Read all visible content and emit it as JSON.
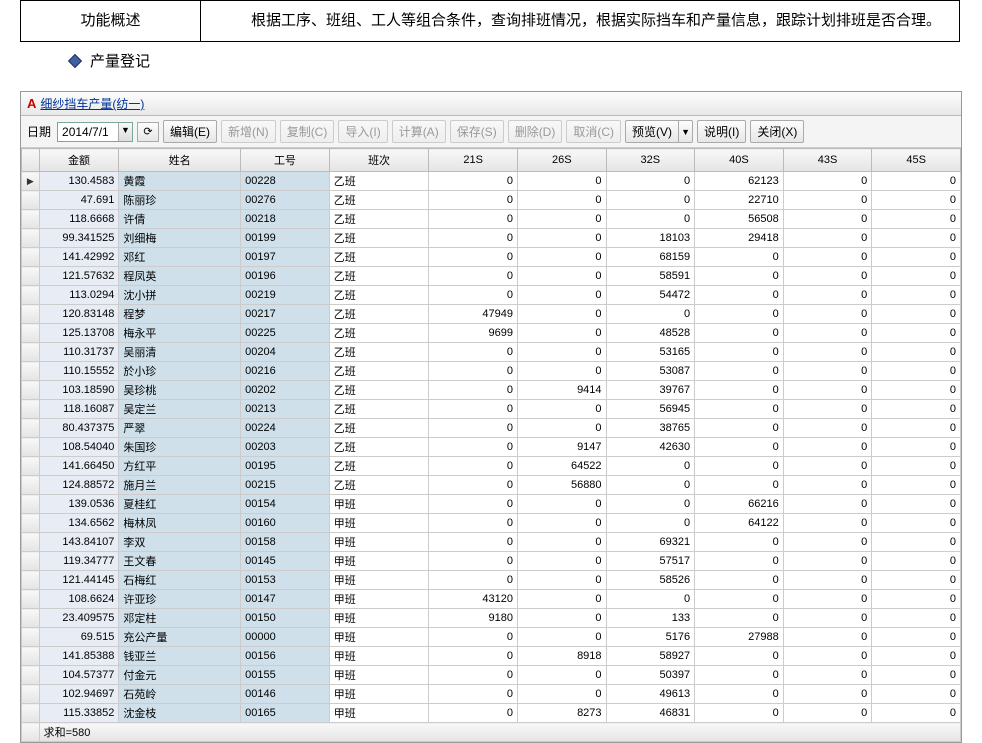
{
  "desc": {
    "label": "功能概述",
    "content": "根据工序、班组、工人等组合条件，查询排班情况，根据实际挡车和产量信息，跟踪计划排班是否合理。"
  },
  "sub_title": "产量登记",
  "window": {
    "title": "细纱挡车产量(纺一)"
  },
  "toolbar": {
    "date_label": "日期",
    "date_value": "2014/7/1",
    "refresh": "⟳",
    "edit": "编辑(E)",
    "add": "新增(N)",
    "copy": "复制(C)",
    "import": "导入(I)",
    "calc": "计算(A)",
    "save": "保存(S)",
    "delete": "删除(D)",
    "cancel": "取消(C)",
    "preview": "预览(V)",
    "help": "说明(I)",
    "close": "关闭(X)"
  },
  "columns": {
    "amount": "金额",
    "name": "姓名",
    "id": "工号",
    "shift": "班次",
    "c21s": "21S",
    "c26s": "26S",
    "c32s": "32S",
    "c40s": "40S",
    "c43s": "43S",
    "c45s": "45S"
  },
  "rows": [
    {
      "amount": "130.4583",
      "name": "黄霞",
      "id": "00228",
      "shift": "乙班",
      "v": [
        0,
        0,
        0,
        62123,
        0,
        0
      ],
      "mark": "▶"
    },
    {
      "amount": "47.691",
      "name": "陈丽珍",
      "id": "00276",
      "shift": "乙班",
      "v": [
        0,
        0,
        0,
        22710,
        0,
        0
      ]
    },
    {
      "amount": "118.6668",
      "name": "许倩",
      "id": "00218",
      "shift": "乙班",
      "v": [
        0,
        0,
        0,
        56508,
        0,
        0
      ]
    },
    {
      "amount": "99.341525",
      "name": "刘细梅",
      "id": "00199",
      "shift": "乙班",
      "v": [
        0,
        0,
        18103,
        29418,
        0,
        0
      ]
    },
    {
      "amount": "141.42992",
      "name": "邓红",
      "id": "00197",
      "shift": "乙班",
      "v": [
        0,
        0,
        68159,
        0,
        0,
        0
      ]
    },
    {
      "amount": "121.57632",
      "name": "程凤英",
      "id": "00196",
      "shift": "乙班",
      "v": [
        0,
        0,
        58591,
        0,
        0,
        0
      ]
    },
    {
      "amount": "113.0294",
      "name": "沈小拼",
      "id": "00219",
      "shift": "乙班",
      "v": [
        0,
        0,
        54472,
        0,
        0,
        0
      ]
    },
    {
      "amount": "120.83148",
      "name": "程梦",
      "id": "00217",
      "shift": "乙班",
      "v": [
        47949,
        0,
        0,
        0,
        0,
        0
      ]
    },
    {
      "amount": "125.13708",
      "name": "梅永平",
      "id": "00225",
      "shift": "乙班",
      "v": [
        9699,
        0,
        48528,
        0,
        0,
        0
      ]
    },
    {
      "amount": "110.31737",
      "name": "吴丽清",
      "id": "00204",
      "shift": "乙班",
      "v": [
        0,
        0,
        53165,
        0,
        0,
        0
      ]
    },
    {
      "amount": "110.15552",
      "name": "於小珍",
      "id": "00216",
      "shift": "乙班",
      "v": [
        0,
        0,
        53087,
        0,
        0,
        0
      ]
    },
    {
      "amount": "103.18590",
      "name": "吴珍桃",
      "id": "00202",
      "shift": "乙班",
      "v": [
        0,
        9414,
        39767,
        0,
        0,
        0
      ]
    },
    {
      "amount": "118.16087",
      "name": "吴定兰",
      "id": "00213",
      "shift": "乙班",
      "v": [
        0,
        0,
        56945,
        0,
        0,
        0
      ]
    },
    {
      "amount": "80.437375",
      "name": "严翠",
      "id": "00224",
      "shift": "乙班",
      "v": [
        0,
        0,
        38765,
        0,
        0,
        0
      ]
    },
    {
      "amount": "108.54040",
      "name": "朱国珍",
      "id": "00203",
      "shift": "乙班",
      "v": [
        0,
        9147,
        42630,
        0,
        0,
        0
      ]
    },
    {
      "amount": "141.66450",
      "name": "方红平",
      "id": "00195",
      "shift": "乙班",
      "v": [
        0,
        64522,
        0,
        0,
        0,
        0
      ]
    },
    {
      "amount": "124.88572",
      "name": "施月兰",
      "id": "00215",
      "shift": "乙班",
      "v": [
        0,
        56880,
        0,
        0,
        0,
        0
      ]
    },
    {
      "amount": "139.0536",
      "name": "夏桂红",
      "id": "00154",
      "shift": "甲班",
      "v": [
        0,
        0,
        0,
        66216,
        0,
        0
      ]
    },
    {
      "amount": "134.6562",
      "name": "梅林凤",
      "id": "00160",
      "shift": "甲班",
      "v": [
        0,
        0,
        0,
        64122,
        0,
        0
      ]
    },
    {
      "amount": "143.84107",
      "name": "李双",
      "id": "00158",
      "shift": "甲班",
      "v": [
        0,
        0,
        69321,
        0,
        0,
        0
      ]
    },
    {
      "amount": "119.34777",
      "name": "王文春",
      "id": "00145",
      "shift": "甲班",
      "v": [
        0,
        0,
        57517,
        0,
        0,
        0
      ]
    },
    {
      "amount": "121.44145",
      "name": "石梅红",
      "id": "00153",
      "shift": "甲班",
      "v": [
        0,
        0,
        58526,
        0,
        0,
        0
      ]
    },
    {
      "amount": "108.6624",
      "name": "许亚珍",
      "id": "00147",
      "shift": "甲班",
      "v": [
        43120,
        0,
        0,
        0,
        0,
        0
      ]
    },
    {
      "amount": "23.409575",
      "name": "邓定柱",
      "id": "00150",
      "shift": "甲班",
      "v": [
        9180,
        0,
        133,
        0,
        0,
        0
      ]
    },
    {
      "amount": "69.515",
      "name": "充公产量",
      "id": "00000",
      "shift": "甲班",
      "v": [
        0,
        0,
        5176,
        27988,
        0,
        0
      ]
    },
    {
      "amount": "141.85388",
      "name": "钱亚兰",
      "id": "00156",
      "shift": "甲班",
      "v": [
        0,
        8918,
        58927,
        0,
        0,
        0
      ]
    },
    {
      "amount": "104.57377",
      "name": "付金元",
      "id": "00155",
      "shift": "甲班",
      "v": [
        0,
        0,
        50397,
        0,
        0,
        0
      ]
    },
    {
      "amount": "102.94697",
      "name": "石苑岭",
      "id": "00146",
      "shift": "甲班",
      "v": [
        0,
        0,
        49613,
        0,
        0,
        0
      ]
    },
    {
      "amount": "115.33852",
      "name": "沈金枝",
      "id": "00165",
      "shift": "甲班",
      "v": [
        0,
        8273,
        46831,
        0,
        0,
        0
      ]
    }
  ],
  "footer": "求和=580"
}
